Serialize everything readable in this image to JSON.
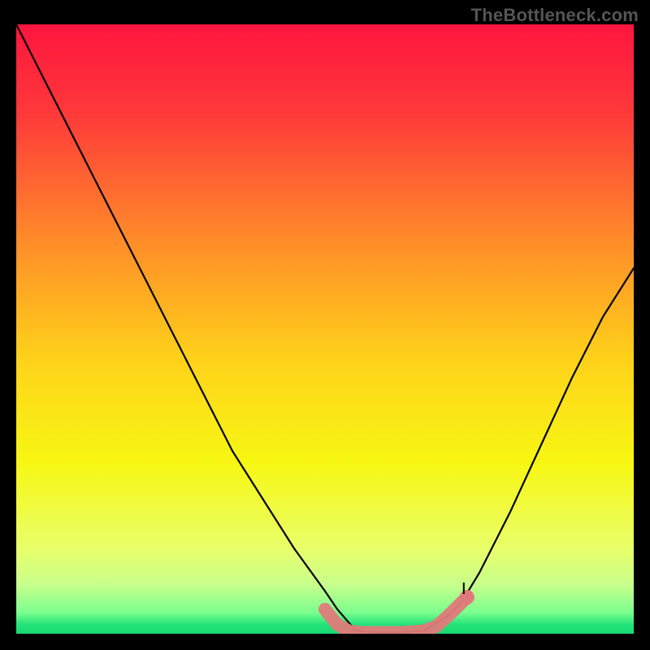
{
  "watermark": "TheBottleneck.com",
  "chart_data": {
    "type": "line",
    "title": "",
    "xlabel": "",
    "ylabel": "",
    "xlim": [
      0,
      100
    ],
    "ylim": [
      0,
      100
    ],
    "grid": false,
    "legend": false,
    "annotations": [],
    "gradient_stops": [
      {
        "offset": 0.0,
        "color": "#ff153f"
      },
      {
        "offset": 0.15,
        "color": "#ff3a3a"
      },
      {
        "offset": 0.35,
        "color": "#ff8a2a"
      },
      {
        "offset": 0.55,
        "color": "#ffd21a"
      },
      {
        "offset": 0.72,
        "color": "#f7f713"
      },
      {
        "offset": 0.86,
        "color": "#e9ff6a"
      },
      {
        "offset": 0.92,
        "color": "#c7ff8c"
      },
      {
        "offset": 0.965,
        "color": "#7bff8e"
      },
      {
        "offset": 0.985,
        "color": "#24e27a"
      },
      {
        "offset": 1.0,
        "color": "#17d970"
      }
    ],
    "series": [
      {
        "name": "bottleneck-curve",
        "color": "#000000",
        "x": [
          0,
          5,
          10,
          15,
          20,
          25,
          30,
          35,
          40,
          45,
          50,
          52,
          55,
          58,
          62,
          66,
          70,
          72,
          75,
          80,
          85,
          90,
          95,
          100
        ],
        "y": [
          100,
          90,
          80,
          70,
          60,
          50,
          40,
          30,
          22,
          14,
          7,
          4,
          0.5,
          0.2,
          0.2,
          0.5,
          3,
          5,
          10,
          20,
          31,
          42,
          52,
          60
        ]
      },
      {
        "name": "valley-floor-marker",
        "color": "#e07a7a",
        "x": [
          50,
          52,
          54,
          56,
          58,
          60,
          62,
          64,
          66,
          68,
          70,
          71,
          72,
          73
        ],
        "y": [
          4,
          1.5,
          0.4,
          0.2,
          0.2,
          0.2,
          0.2,
          0.3,
          0.5,
          1.2,
          3,
          4,
          5,
          6
        ]
      }
    ]
  }
}
